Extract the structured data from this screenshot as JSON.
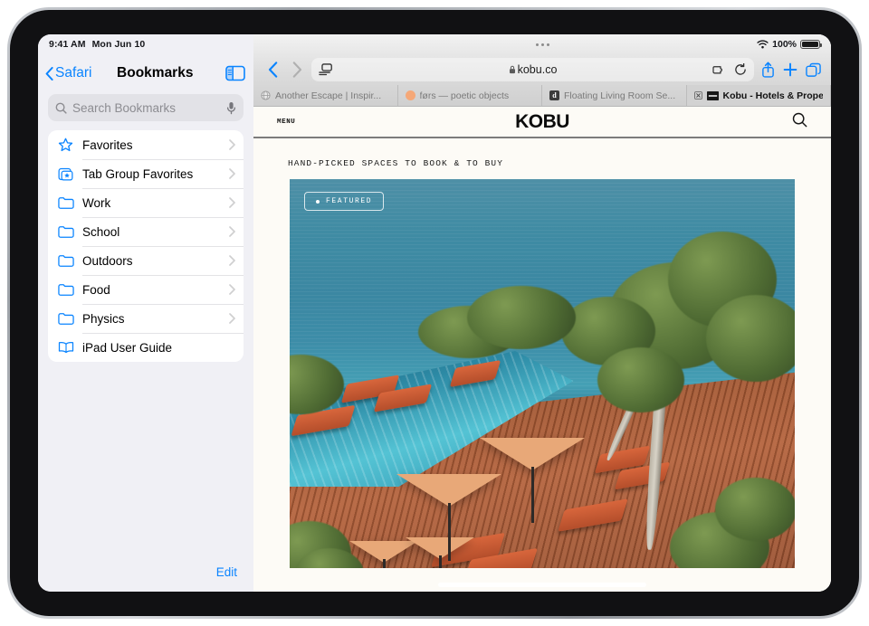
{
  "status_bar": {
    "time": "9:41 AM",
    "date": "Mon Jun 10",
    "battery": "100%",
    "wifi_icon": "wifi-icon"
  },
  "sidebar": {
    "back_label": "Safari",
    "title": "Bookmarks",
    "toggle_icon": "sidebar-toggle-icon",
    "search": {
      "placeholder": "Search Bookmarks",
      "icon": "search-icon",
      "mic_icon": "microphone-icon"
    },
    "items": [
      {
        "label": "Favorites",
        "icon": "star-icon",
        "chevron": true
      },
      {
        "label": "Tab Group Favorites",
        "icon": "tab-group-star-icon",
        "chevron": true
      },
      {
        "label": "Work",
        "icon": "folder-icon",
        "chevron": true
      },
      {
        "label": "School",
        "icon": "folder-icon",
        "chevron": true
      },
      {
        "label": "Outdoors",
        "icon": "folder-icon",
        "chevron": true
      },
      {
        "label": "Food",
        "icon": "folder-icon",
        "chevron": true
      },
      {
        "label": "Physics",
        "icon": "folder-icon",
        "chevron": true
      },
      {
        "label": "iPad User Guide",
        "icon": "book-icon",
        "chevron": false
      }
    ],
    "edit_label": "Edit"
  },
  "browser": {
    "back_icon": "chevron-left-icon",
    "forward_icon": "chevron-right-icon",
    "sidebar_icon": "reader-sidebar-icon",
    "url": "kobu.co",
    "lock_icon": "lock-icon",
    "extensions_icon": "puzzle-icon",
    "reload_icon": "reload-icon",
    "share_icon": "share-icon",
    "new_tab_icon": "plus-icon",
    "tab_overview_icon": "tabs-icon",
    "tabs": [
      {
        "title": "Another Escape | Inspir...",
        "favicon": "globe-icon",
        "active": false,
        "closeable": false
      },
      {
        "title": "førs — poetic objects",
        "favicon": "orange-circle-icon",
        "active": false,
        "closeable": false
      },
      {
        "title": "Floating Living Room Se...",
        "favicon": "letter-d-icon",
        "active": false,
        "closeable": false
      },
      {
        "title": "Kobu - Hotels & Propert...",
        "favicon": "kobu-icon",
        "active": true,
        "closeable": true
      }
    ]
  },
  "page": {
    "menu_label": "MENU",
    "brand": "KOBU",
    "search_icon": "search-icon",
    "tagline": "HAND-PICKED SPACES TO BOOK & TO BUY",
    "hero": {
      "badge_label": "FEATURED",
      "badge_dot": "dot-icon"
    }
  },
  "colors": {
    "accent": "#0a84ff",
    "page_bg": "#fdfbf6",
    "sidebar_bg": "#f0f0f5"
  }
}
